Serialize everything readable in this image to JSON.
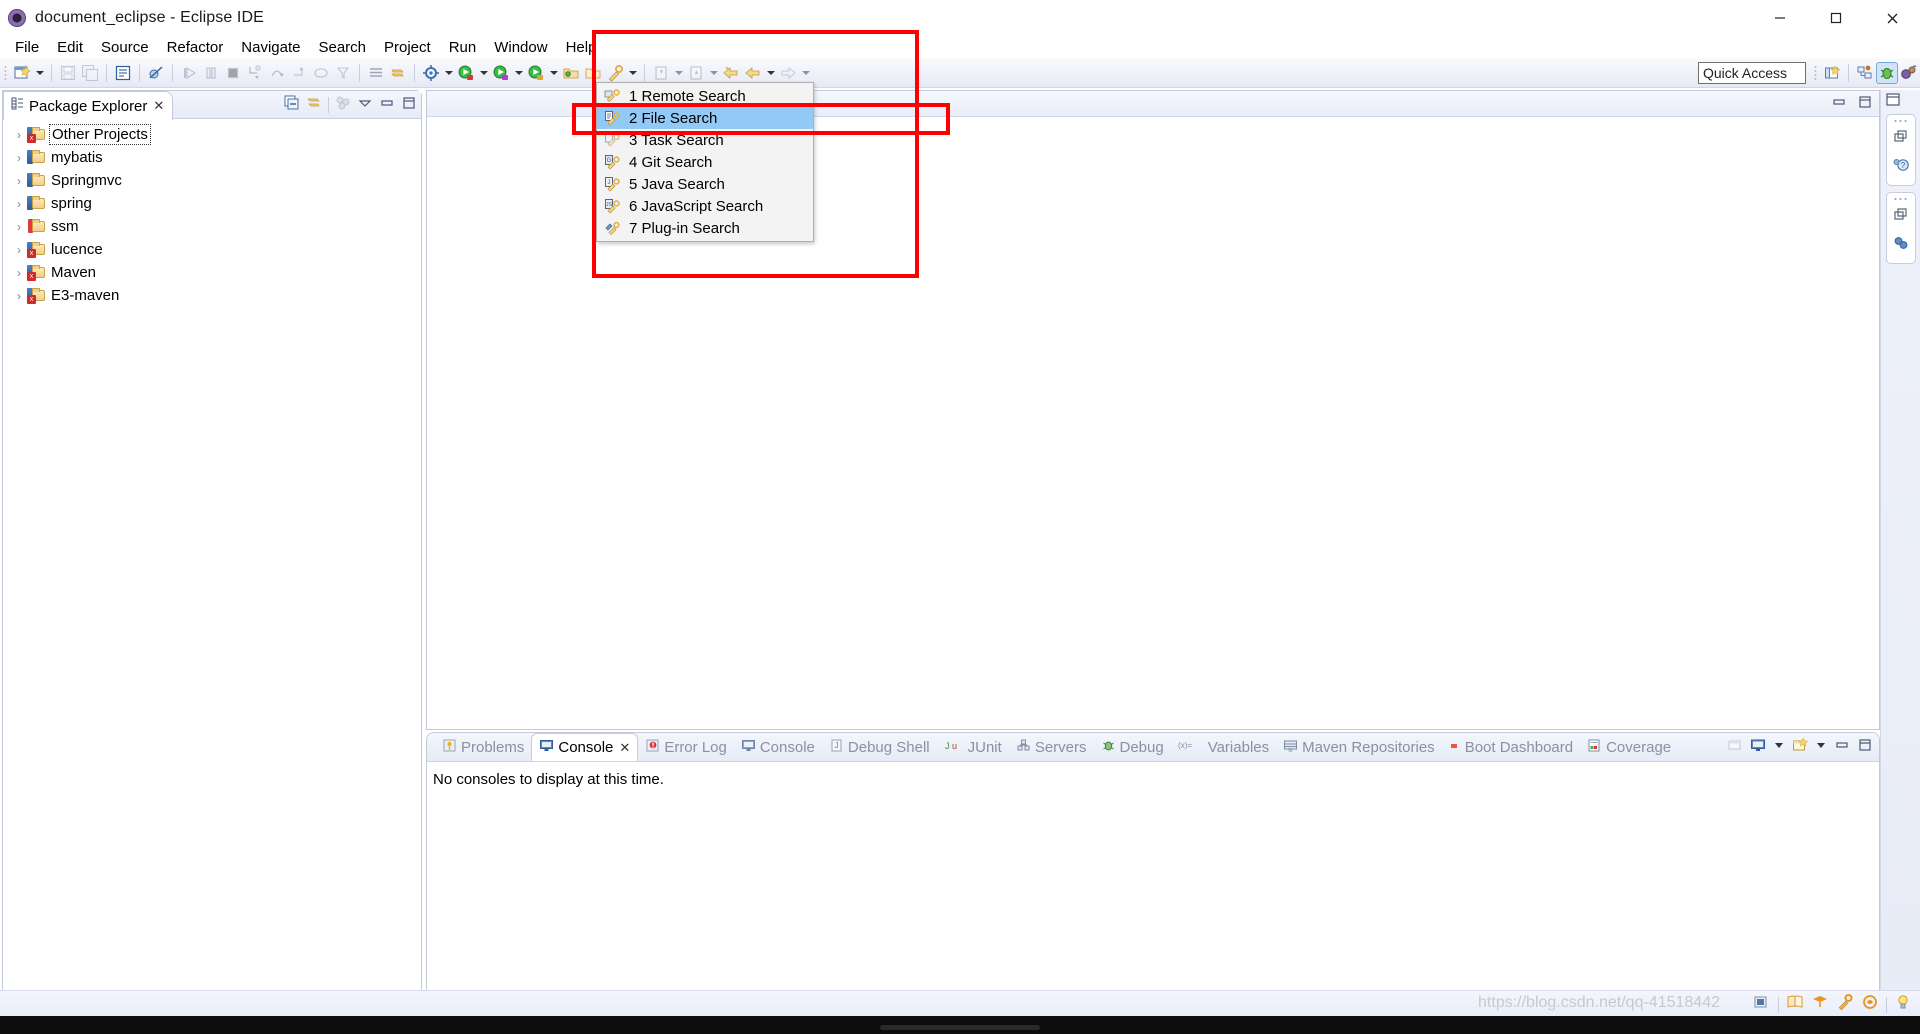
{
  "window": {
    "title": "document_eclipse - Eclipse IDE",
    "icon": "eclipse-logo-icon",
    "minimize": "minimize-button",
    "maximize": "maximize-button",
    "close": "close-button"
  },
  "menubar": {
    "items": [
      {
        "label": "File",
        "mnemonic": "F"
      },
      {
        "label": "Edit",
        "mnemonic": "E"
      },
      {
        "label": "Source",
        "mnemonic": "S"
      },
      {
        "label": "Refactor",
        "mnemonic": "t"
      },
      {
        "label": "Navigate",
        "mnemonic": "N"
      },
      {
        "label": "Search",
        "mnemonic": "a"
      },
      {
        "label": "Project",
        "mnemonic": "P"
      },
      {
        "label": "Run",
        "mnemonic": "R"
      },
      {
        "label": "Window",
        "mnemonic": "W"
      },
      {
        "label": "Help",
        "mnemonic": "H"
      }
    ]
  },
  "toolbar": {
    "quick_access": {
      "placeholder": "Quick Access",
      "value": "Quick Access"
    },
    "perspective_buttons": [
      "open-perspective-icon",
      "java-ee-perspective-icon",
      "debug-perspective-icon",
      "java-perspective-icon"
    ]
  },
  "search_menu": {
    "name": "search-dropdown-menu",
    "items": [
      {
        "label": "1 Remote Search",
        "icon": "remote-search-icon",
        "selected": false
      },
      {
        "label": "2 File Search",
        "icon": "file-search-icon",
        "selected": true
      },
      {
        "label": "3 Task Search",
        "icon": "task-search-icon",
        "selected": false
      },
      {
        "label": "4 Git Search",
        "icon": "git-search-icon",
        "selected": false
      },
      {
        "label": "5 Java Search",
        "icon": "java-search-icon",
        "selected": false
      },
      {
        "label": "6 JavaScript Search",
        "icon": "javascript-search-icon",
        "selected": false
      },
      {
        "label": "7 Plug-in Search",
        "icon": "plugin-search-icon",
        "selected": false
      }
    ]
  },
  "explorer": {
    "tab_label": "Package Explorer",
    "tab_icon": "package-explorer-icon",
    "close_glyph": "✕",
    "tools": [
      "collapse-all-icon",
      "link-with-editor-icon",
      "view-menu-icon",
      "minimize-icon",
      "maximize-icon"
    ],
    "tree": [
      {
        "label": "Other Projects",
        "icon": "java-project-error-icon",
        "state": "collapsed",
        "focused": true
      },
      {
        "label": "mybatis",
        "icon": "java-project-icon",
        "state": "collapsed",
        "focused": false
      },
      {
        "label": "Springmvc",
        "icon": "java-project-icon",
        "state": "collapsed",
        "focused": false
      },
      {
        "label": "spring",
        "icon": "java-project-icon",
        "state": "collapsed",
        "focused": false
      },
      {
        "label": "ssm",
        "icon": "java-project-warning-icon",
        "state": "collapsed",
        "focused": false
      },
      {
        "label": "lucence",
        "icon": "java-project-error-icon",
        "state": "collapsed",
        "focused": false
      },
      {
        "label": "Maven",
        "icon": "java-project-error-icon",
        "state": "collapsed",
        "focused": false
      },
      {
        "label": "E3-maven",
        "icon": "java-project-error-icon",
        "state": "collapsed",
        "focused": false
      }
    ]
  },
  "bottom_panel": {
    "tabs": [
      {
        "label": "Problems",
        "icon": "problems-icon",
        "active": false,
        "closable": false
      },
      {
        "label": "Console",
        "icon": "console-icon",
        "active": true,
        "closable": true
      },
      {
        "label": "Error Log",
        "icon": "error-log-icon",
        "active": false,
        "closable": false
      },
      {
        "label": "Console",
        "icon": "console-icon",
        "active": false,
        "closable": false
      },
      {
        "label": "Debug Shell",
        "icon": "debug-shell-icon",
        "active": false,
        "closable": false
      },
      {
        "label": "JUnit",
        "icon": "junit-icon",
        "active": false,
        "closable": false
      },
      {
        "label": "Servers",
        "icon": "servers-icon",
        "active": false,
        "closable": false
      },
      {
        "label": "Debug",
        "icon": "debug-icon",
        "active": false,
        "closable": false
      },
      {
        "label": "Variables",
        "icon": "variables-icon",
        "active": false,
        "closable": false
      },
      {
        "label": "Maven Repositories",
        "icon": "maven-repositories-icon",
        "active": false,
        "closable": false
      },
      {
        "label": "Boot Dashboard",
        "icon": "boot-dashboard-icon",
        "active": false,
        "closable": false
      },
      {
        "label": "Coverage",
        "icon": "coverage-icon",
        "active": false,
        "closable": false
      }
    ],
    "close_glyph": "✕",
    "body_text": "No consoles to display at this time.",
    "tools": [
      "open-console-icon",
      "display-selected-console-icon",
      "console-dropdown-icon",
      "new-console-view-icon",
      "new-console-dropdown-icon",
      "minimize-icon",
      "maximize-icon"
    ]
  },
  "status_bar": {
    "watermark": "https://blog.csdn.net/qq-41518442",
    "icons": [
      "writable-icon",
      "smart-insert-icon",
      "position-icon",
      "java-ee-icon",
      "search-icon",
      "tip-icon",
      "bulb-icon"
    ]
  },
  "right_rail": {
    "groups": [
      {
        "icons": [
          "restore-icon",
          "help-view-icon"
        ]
      },
      {
        "icons": [
          "restore-icon",
          "team-sync-icon"
        ]
      }
    ]
  },
  "annotations": [
    {
      "name": "annotation-box-menu",
      "color": "#ff0000"
    },
    {
      "name": "annotation-box-file-search",
      "color": "#ff0000"
    }
  ]
}
